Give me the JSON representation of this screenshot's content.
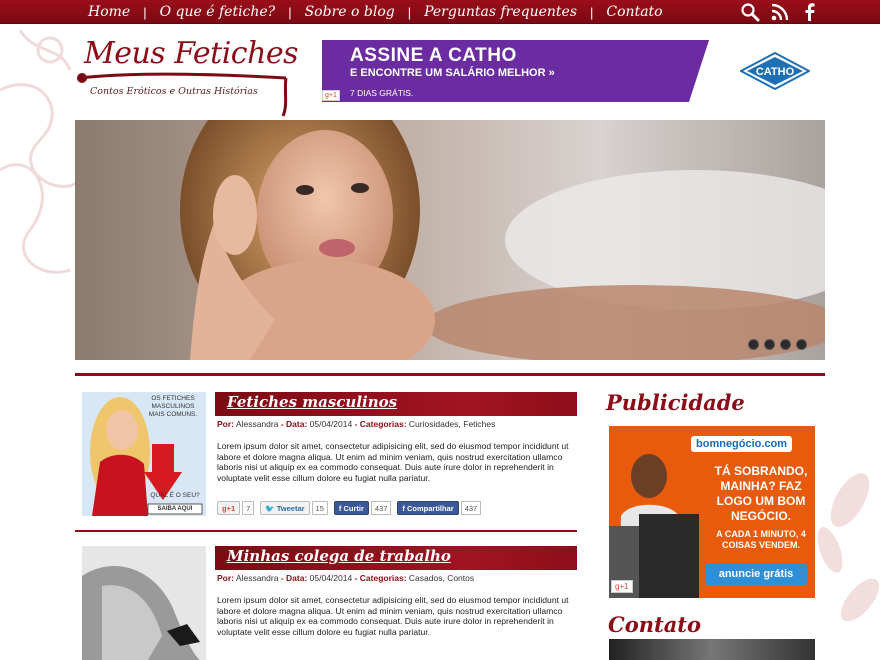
{
  "nav": {
    "items": [
      "Home",
      "O que é fetiche?",
      "Sobre o blog",
      "Perguntas frequentes",
      "Contato"
    ],
    "icons": [
      "search-icon",
      "rss-icon",
      "facebook-icon"
    ]
  },
  "logo": {
    "title": "Meus Fetiches",
    "subtitle": "Contos Eróticos e Outras Histórias"
  },
  "banner": {
    "line1": "ASSINE A CATHO",
    "line2": "E ENCONTRE UM SALÁRIO MELHOR",
    "line3": "7 DIAS GRÁTIS.",
    "brand": "CATHO",
    "gplus": "g+1"
  },
  "slider": {
    "dots": 4
  },
  "posts": [
    {
      "title": "Fetiches masculinos",
      "meta_by_label": "Por:",
      "author": "Alessandra",
      "meta_date_label": "Data:",
      "date": "05/04/2014",
      "meta_cat_label": "Categorias:",
      "categories": "Curiosidades, Fetiches",
      "excerpt": "Lorem ipsum dolor sit amet, consectetur adipisicing elit, sed do eiusmod tempor incididunt ut labore et dolore magna aliqua. Ut enim ad minim veniam, quis nostrud exercitation ullamco laboris nisi ut aliquip ex ea commodo consequat. Duis aute irure dolor in reprehenderit in voluptate velit esse cillum dolore eu fugiat nulla pariatur.",
      "thumb_text": {
        "top": "OS FETICHES MASCULINOS MAIS COMUNS.",
        "question": "QUAL É O SEU?",
        "cta": "SAIBA AQUI"
      },
      "share": {
        "gplus_label": "g+1",
        "gplus_count": "7",
        "tweet_label": "Tweetar",
        "tweet_count": "15",
        "like_label": "Curtir",
        "like_count": "437",
        "share_label": "Compartilhar",
        "share_count": "437"
      }
    },
    {
      "title": "Minhas colega de trabalho",
      "meta_by_label": "Por:",
      "author": "Alessandra",
      "meta_date_label": "Data:",
      "date": "05/04/2014",
      "meta_cat_label": "Categorias:",
      "categories": "Casados, Contos",
      "excerpt": "Lorem ipsum dolor sit amet, consectetur adipisicing elit, sed do eiusmod tempor incididunt ut labore et dolore magna aliqua. Ut enim ad minim veniam, quis nostrud exercitation ullamco laboris nisi ut aliquip ex ea commodo consequat. Duis aute irure dolor in reprehenderit in voluptate velit esse cillum dolore eu fugiat nulla pariatur."
    }
  ],
  "sidebar": {
    "ad_heading": "Publicidade",
    "ad": {
      "brand": "bomnegócio.com",
      "headline": "TÁ SOBRANDO, MAINHA? FAZ LOGO UM BOM NEGÓCIO.",
      "sub": "A CADA 1 MINUTO, 4 COISAS VENDEM.",
      "cta": "anuncie grátis",
      "gplus": "g+1"
    },
    "contact_heading": "Contato"
  },
  "colors": {
    "brand_red": "#8a0d18",
    "catho_purple": "#6a2ca0",
    "olx_orange": "#e85a0c",
    "facebook_blue": "#3b5998"
  }
}
